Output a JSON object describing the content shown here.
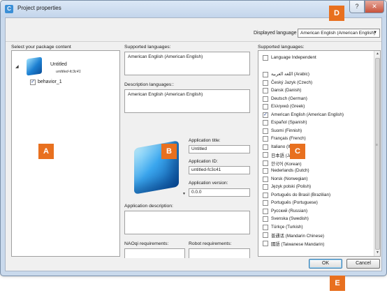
{
  "window": {
    "title": "Project properties",
    "app_icon_glyph": "C",
    "help_glyph": "?",
    "close_glyph": "✕"
  },
  "displayed_language": {
    "label": "Displayed language",
    "value": "American English (American English)"
  },
  "package_panel": {
    "label": "Select your package content",
    "root": {
      "name": "Untitled",
      "id": "untitled-fc3c41"
    },
    "children": [
      {
        "label": "behavior_1",
        "checked": true
      }
    ]
  },
  "middle": {
    "supported_languages_label": "Supported languages:",
    "supported_languages_value": "American English (American English)",
    "description_languages_label": "Description languages::",
    "description_languages_value": "American English (American English)",
    "application_title_label": "Application title:",
    "application_title_value": "Untitled",
    "application_id_label": "Application ID:",
    "application_id_value": "untitled-fc3c41",
    "application_version_label": "Application version:",
    "application_version_value": "0.0.0",
    "application_description_label": "Application description:",
    "naoqi_requirements_label": "NAOqi requirements:",
    "robot_requirements_label": "Robot requirements:"
  },
  "languages_panel": {
    "label": "Supported languages:",
    "independent": {
      "label": "Language Independent",
      "checked": false
    },
    "items": [
      {
        "label": "اللغة العربية (Arabic)",
        "checked": false
      },
      {
        "label": "Český Jazyk (Czech)",
        "checked": false
      },
      {
        "label": "Dansk (Danish)",
        "checked": false
      },
      {
        "label": "Deutsch (German)",
        "checked": false
      },
      {
        "label": "Ελληνικά (Greek)",
        "checked": false
      },
      {
        "label": "American English (American English)",
        "checked": true
      },
      {
        "label": "Español (Spanish)",
        "checked": false
      },
      {
        "label": "Suomi (Finnish)",
        "checked": false
      },
      {
        "label": "Français (French)",
        "checked": false
      },
      {
        "label": "Italiano (Ita",
        "checked": false
      },
      {
        "label": "日本語 (Jap",
        "checked": false
      },
      {
        "label": "한국어 (Korean)",
        "checked": false
      },
      {
        "label": "Nederlands (Dutch)",
        "checked": false
      },
      {
        "label": "Norsk (Norwegian)",
        "checked": false
      },
      {
        "label": "Język polski (Polish)",
        "checked": false
      },
      {
        "label": "Português do Brasil (Brazilian)",
        "checked": false
      },
      {
        "label": "Português (Portuguese)",
        "checked": false
      },
      {
        "label": "Русский (Russian)",
        "checked": false
      },
      {
        "label": "Svenska (Swedish)",
        "checked": false
      },
      {
        "label": "Türkçe (Turkish)",
        "checked": false
      },
      {
        "label": "普通话 (Mandarin Chinese)",
        "checked": false
      },
      {
        "label": "國語 (Taiwanese Mandarin)",
        "checked": false
      }
    ]
  },
  "buttons": {
    "ok": "OK",
    "cancel": "Cancel"
  },
  "markers": {
    "a": "A",
    "b": "B",
    "c": "C",
    "d": "D",
    "e": "E"
  },
  "colors": {
    "marker": "#e8701f",
    "titlebar": "#c9d9ec",
    "close": "#c8523b"
  },
  "icons": {
    "tree_toggle": "triangle-down-icon",
    "dropdown": "chevron-down-icon",
    "check": "checkmark-icon"
  }
}
